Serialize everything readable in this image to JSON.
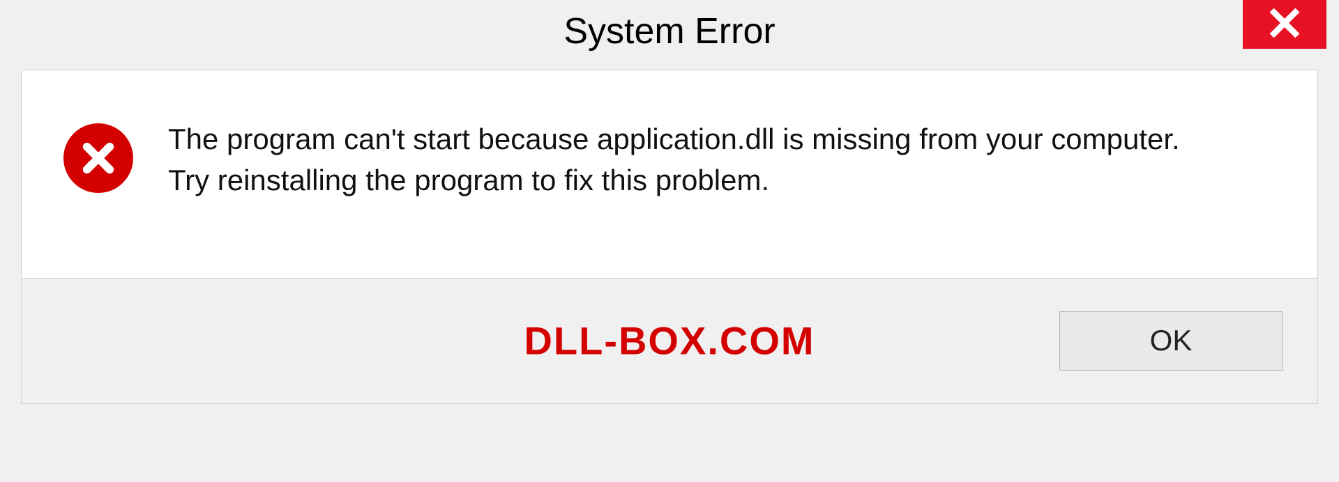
{
  "title": "System Error",
  "message": "The program can't start because application.dll is missing from your computer. Try reinstalling the program to fix this problem.",
  "watermark": "DLL-BOX.COM",
  "buttons": {
    "ok": "OK"
  },
  "colors": {
    "error_red": "#d40000",
    "close_red": "#e81123"
  }
}
